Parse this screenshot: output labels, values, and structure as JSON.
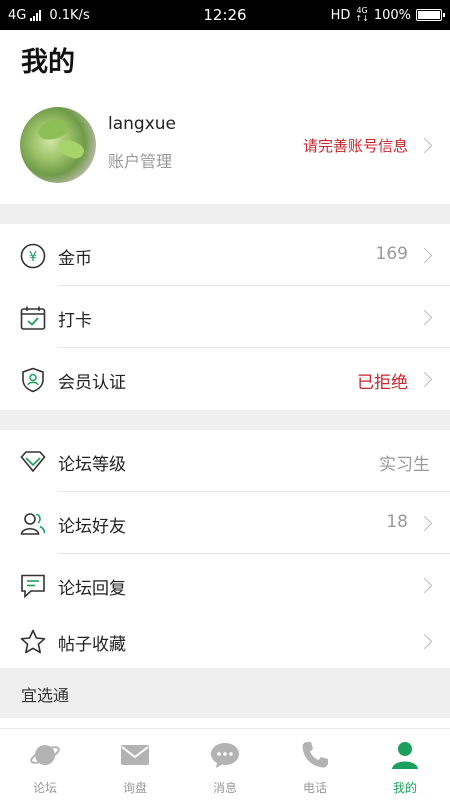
{
  "status_bar": {
    "network": "4G",
    "speed": "0.1K/s",
    "time": "12:26",
    "hd": "HD",
    "net_small_top": "4G",
    "net_small_bottom": "↑↓",
    "battery": "100%",
    "battery_level": 1.0
  },
  "page": {
    "title": "我的"
  },
  "profile": {
    "username": "langxue",
    "account_label": "账户管理",
    "complete_info": "请完善账号信息"
  },
  "group1": [
    {
      "label": "金币",
      "value": "169",
      "icon": "yuan-coin-icon"
    },
    {
      "label": "打卡",
      "value": "",
      "icon": "calendar-check-icon"
    },
    {
      "label": "会员认证",
      "value": "已拒绝",
      "icon": "shield-user-icon"
    }
  ],
  "group2": [
    {
      "label": "论坛等级",
      "value": "实习生",
      "icon": "diamond-icon"
    },
    {
      "label": "论坛好友",
      "value": "18",
      "icon": "friends-icon"
    },
    {
      "label": "论坛回复",
      "value": "",
      "icon": "comment-icon"
    },
    {
      "label": "帖子收藏",
      "value": "",
      "icon": "star-icon"
    }
  ],
  "section": {
    "title": "宜选通"
  },
  "colors": {
    "accent": "#1aa05a",
    "alert": "#c8262c",
    "muted": "#999999",
    "separator": "#efefef"
  },
  "bottom_nav": [
    {
      "label": "论坛",
      "icon": "planet-icon"
    },
    {
      "label": "询盘",
      "icon": "mail-icon"
    },
    {
      "label": "消息",
      "icon": "chat-bubble-icon"
    },
    {
      "label": "电话",
      "icon": "phone-icon"
    },
    {
      "label": "我的",
      "icon": "user-icon",
      "active": true
    }
  ]
}
